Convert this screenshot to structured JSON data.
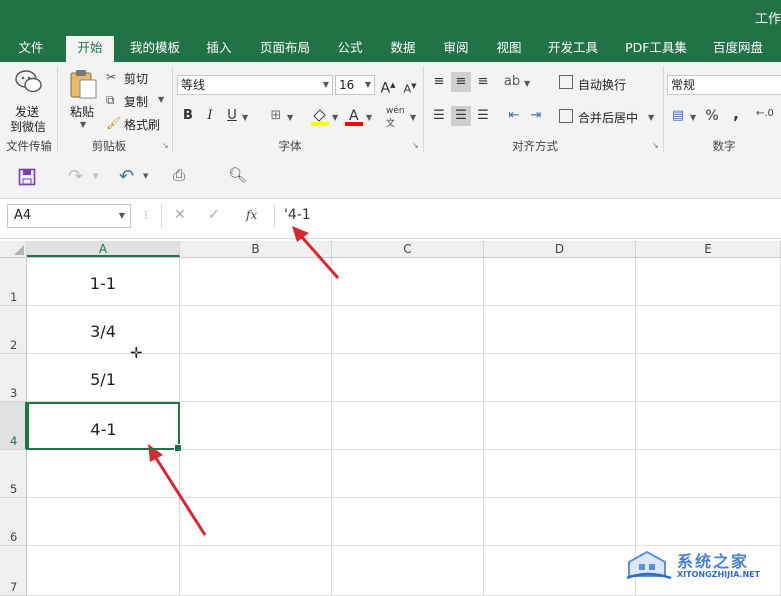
{
  "window": {
    "title": "工作"
  },
  "tabs": [
    "文件",
    "开始",
    "我的模板",
    "插入",
    "页面布局",
    "公式",
    "数据",
    "审阅",
    "视图",
    "开发工具",
    "PDF工具集",
    "百度网盘"
  ],
  "active_tab": "开始",
  "ribbon": {
    "file_transfer": {
      "send_line1": "发送",
      "send_line2": "到微信",
      "group_label": "文件传输"
    },
    "clipboard": {
      "paste": "粘贴",
      "cut": "剪切",
      "copy": "复制",
      "format_painter": "格式刷",
      "group_label": "剪贴板"
    },
    "font": {
      "name": "等线",
      "size": "16",
      "bold": "B",
      "italic": "I",
      "underline": "U",
      "grow": "A",
      "shrink": "A",
      "group_label": "字体",
      "fill_color": "#ffff00",
      "font_color": "#ff0000"
    },
    "alignment": {
      "wrap_text": "自动换行",
      "merge_center": "合并后居中",
      "group_label": "对齐方式"
    },
    "number": {
      "format": "常规",
      "percent": "%",
      "comma": ",",
      "group_label": "数字"
    }
  },
  "formula_bar": {
    "name_box": "A4",
    "cancel": "✕",
    "enter": "✓",
    "fx": "fx",
    "content": "'4-1"
  },
  "grid": {
    "columns": [
      "A",
      "B",
      "C",
      "D",
      "E"
    ],
    "rows": [
      "1",
      "2",
      "3",
      "4",
      "5",
      "6",
      "7"
    ],
    "cells": {
      "A1": "1-1",
      "A2": "3/4",
      "A3": "5/1",
      "A4": "4-1"
    },
    "selected": "A4"
  },
  "watermark": {
    "text_main": "系统之家",
    "text_url": "XITONGZHIJIA.NET"
  },
  "colors": {
    "brand_green": "#217346",
    "annotation_red": "#d9272e",
    "selection_green": "#217346"
  }
}
